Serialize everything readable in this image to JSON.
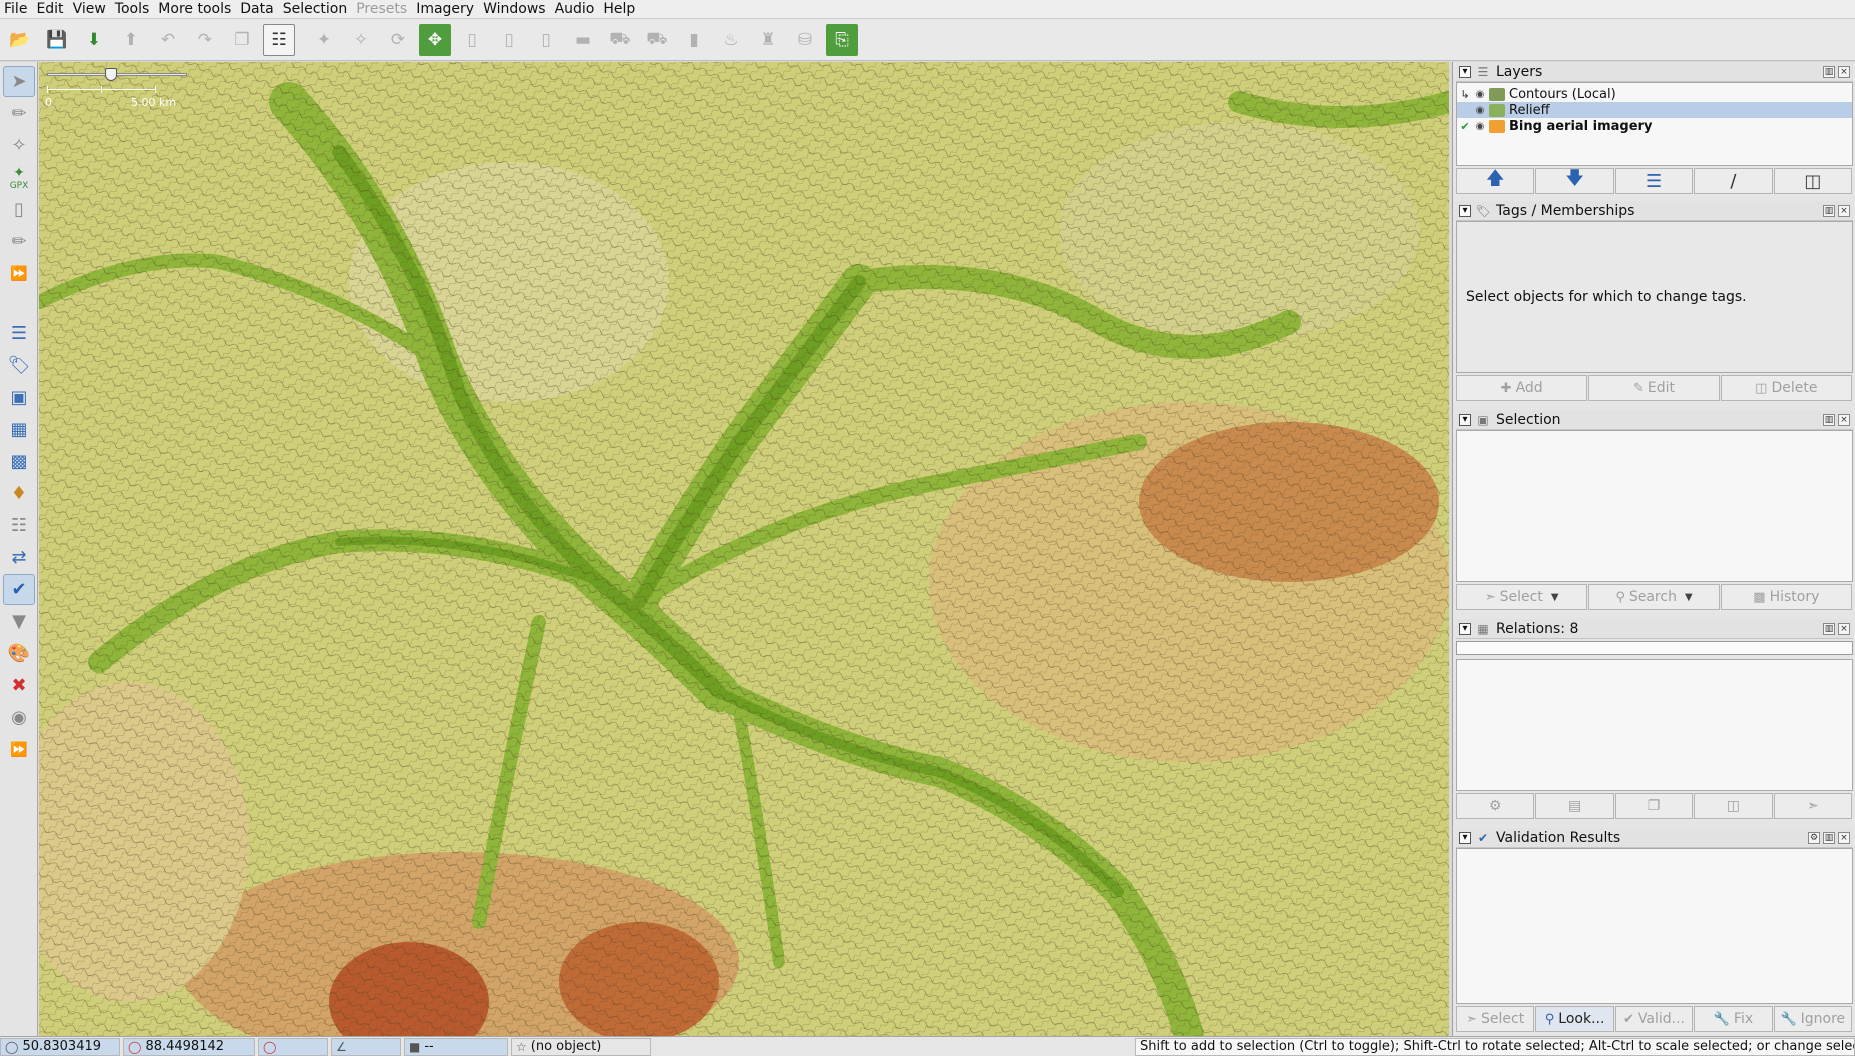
{
  "menu": [
    "File",
    "Edit",
    "View",
    "Tools",
    "More tools",
    "Data",
    "Selection",
    "Presets",
    "Imagery",
    "Windows",
    "Audio",
    "Help"
  ],
  "menu_disabled": "Presets",
  "toolbar": {
    "icons": [
      "open-file-icon",
      "save-icon",
      "download-icon",
      "upload-icon",
      "undo-icon",
      "redo-icon",
      "copy-icon",
      "paste-tags-icon",
      "split-way-icon",
      "combine-way-icon",
      "reverse-icon",
      "zoom-to-fit-icon",
      "align-icon",
      "orthogonal-icon",
      "straighten-icon",
      "building-icon",
      "car-icon",
      "bus-icon",
      "barrier-icon",
      "restaurant-icon",
      "castle-icon",
      "factory-icon",
      "measure-icon"
    ]
  },
  "left_tools": {
    "gpx_label": "GPX",
    "icons": [
      "select-icon",
      "draw-icon",
      "improve-way-icon",
      "gpx-icon",
      "area-icon",
      "lasso-icon",
      "more-icon",
      "layers-icon",
      "tags-icon",
      "selection-list-icon",
      "relation-icon",
      "history-icon",
      "conflict-icon",
      "filter-icon",
      "minimap-icon",
      "validation-icon",
      "filter-funnel-icon",
      "map-paint-icon",
      "notes-icon",
      "wiki-icon",
      "more-icon-2"
    ]
  },
  "map": {
    "scale_start": "0",
    "scale_end": "5.00 km",
    "colors": {
      "valley": "#7eae2b",
      "low": "#b6c95a",
      "mid": "#d9d98b",
      "high": "#c98a4d",
      "peak": "#b85a2e",
      "contour": "#5a4a2a"
    }
  },
  "layers_panel": {
    "title": "Layers",
    "items": [
      {
        "name": "Contours (Local)",
        "color": "#7f9b56"
      },
      {
        "name": "Relieff",
        "color": "#8bb05a"
      },
      {
        "name": "Bing aerial imagery",
        "color": "#f0a030"
      }
    ],
    "buttons": [
      "move-up-icon",
      "move-down-icon",
      "activate-icon",
      "show-hide-icon",
      "delete-layer-icon"
    ]
  },
  "tags_panel": {
    "title": "Tags / Memberships",
    "message": "Select objects for which to change tags.",
    "buttons": [
      "Add",
      "Edit",
      "Delete"
    ]
  },
  "selection_panel": {
    "title": "Selection",
    "buttons": [
      "Select",
      "Search",
      "History"
    ]
  },
  "relations_panel": {
    "title": "Relations: 8"
  },
  "validation_panel": {
    "title": "Validation Results",
    "buttons": [
      "Select",
      "Look...",
      "Valid...",
      "Fix",
      "Ignore"
    ]
  },
  "status": {
    "lat": "50.8303419",
    "lon": "88.4498142",
    "distance": "--",
    "object": "(no object)",
    "help": "Shift to add to selection (Ctrl to toggle); Shift-Ctrl to rotate selected; Alt-Ctrl to scale selected; or change selection"
  }
}
